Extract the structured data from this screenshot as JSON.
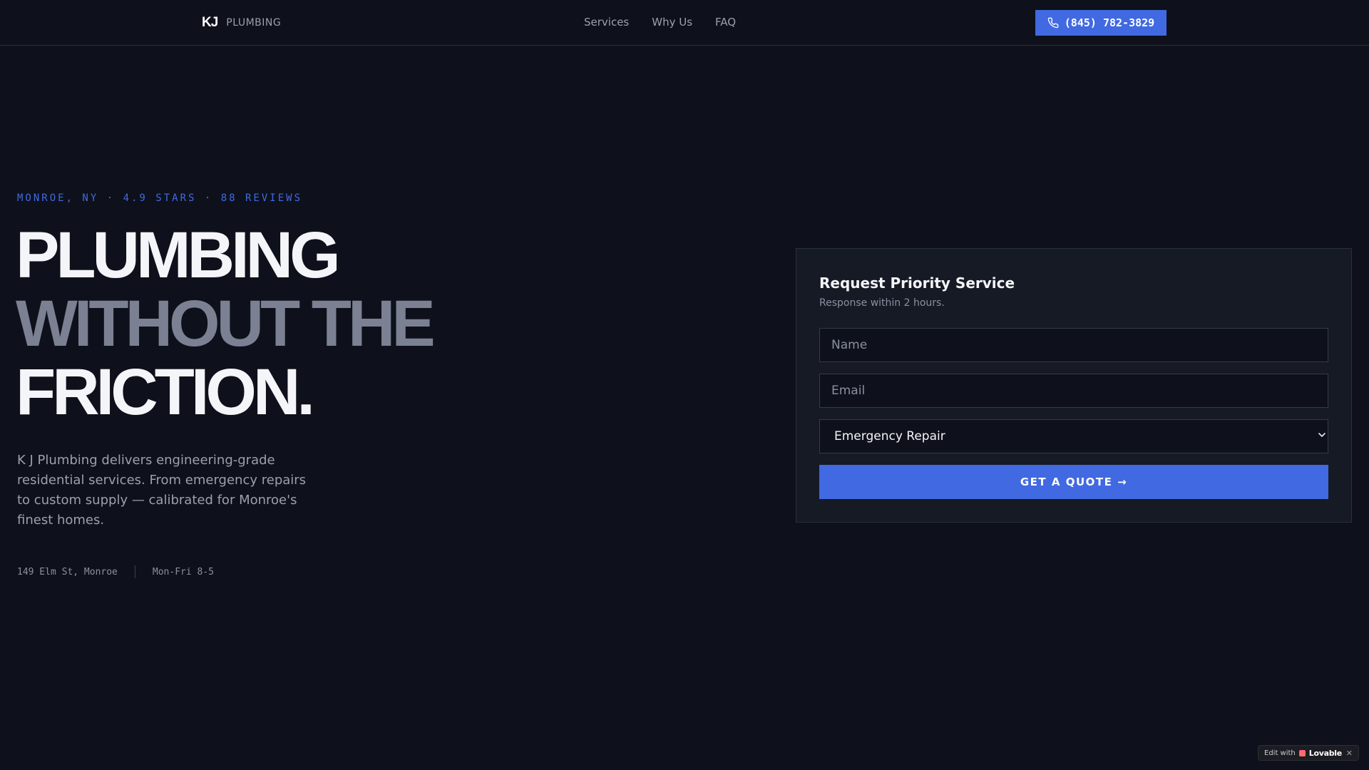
{
  "header": {
    "logo_mark": "KJ",
    "logo_word": "PLUMBING",
    "nav": [
      "Services",
      "Why Us",
      "FAQ"
    ],
    "phone": "(845) 782-3829",
    "phone_icon": "phone-icon"
  },
  "hero": {
    "eyebrow": "MONROE, NY · 4.9 STARS · 88 REVIEWS",
    "headline_line1": "PLUMBING",
    "headline_line2": "WITHOUT THE",
    "headline_line3": "FRICTION.",
    "intro": "K J Plumbing delivers engineering-grade residential services. From emergency repairs to custom supply — calibrated for Monroe's finest homes.",
    "address": "149 Elm St, Monroe",
    "hours": "Mon-Fri 8-5"
  },
  "form": {
    "title": "Request Priority Service",
    "subtitle": "Response within 2 hours.",
    "name_placeholder": "Name",
    "email_placeholder": "Email",
    "service_selected": "Emergency Repair",
    "submit_label": "GET A QUOTE →"
  },
  "badge": {
    "prefix": "Edit with",
    "brand": "Lovable",
    "close": "✕"
  },
  "colors": {
    "background": "#0e111b",
    "accent": "#4169e1",
    "card": "#161a25",
    "muted_text": "#9aa0ad",
    "headline_dim": "#7b8092"
  }
}
